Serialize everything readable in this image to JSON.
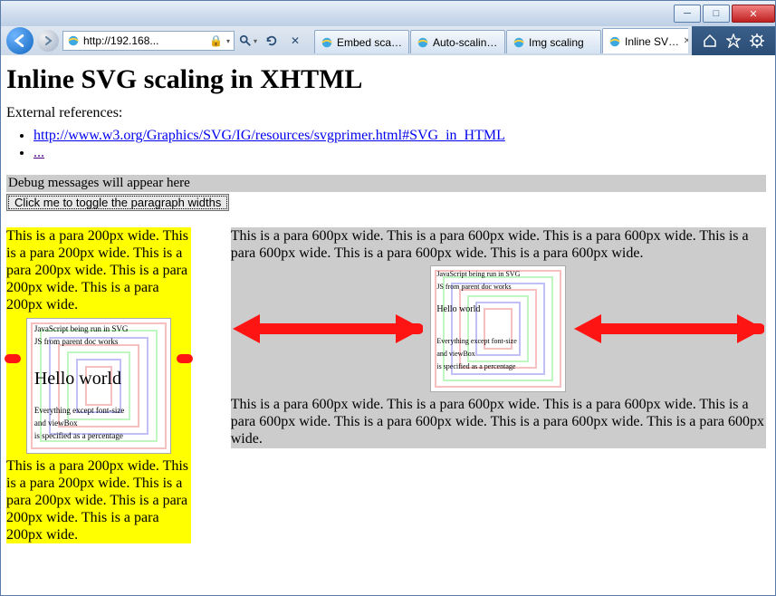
{
  "window": {
    "minimize": "▁",
    "maximize": "▢",
    "close": "✕"
  },
  "nav": {
    "url_text": "http://192.168...",
    "search_placeholder": "Search"
  },
  "tabs": {
    "t0": "Embed scaling",
    "t1": "Auto-scaling a...",
    "t2": "Img scaling",
    "t3": "Inline SVG s..."
  },
  "page": {
    "title": "Inline SVG scaling in XHTML",
    "refs_label": "External references:",
    "link1": "http://www.w3.org/Graphics/SVG/IG/resources/svgprimer.html#SVG_in_HTML",
    "link2": "...",
    "debug_msg": "Debug messages will appear here",
    "toggle_btn": "Click me to toggle the paragraph widths",
    "para200": "This is a para 200px wide. This is a para 200px wide. This is a para 200px wide. This is a para 200px wide. This is a para 200px wide.",
    "para600a": "This is a para 600px wide. This is a para 600px wide. This is a para 600px wide. This is a para 600px wide. This is a para 600px wide. This is a para 600px wide.",
    "para600b": "This is a para 600px wide. This is a para 600px wide. This is a para 600px wide. This is a para 600px wide. This is a para 600px wide. This is a para 600px wide. This is a para 600px wide."
  },
  "svg": {
    "js_run": "JavaScript being run in SVG",
    "js_parent": "JS from parent doc works",
    "hello": "Hello world",
    "everything": "Everything except font-size",
    "and_vb": "and viewBox",
    "specified": "is specified as a percentage",
    "nest_colors": [
      "#f7b7b7",
      "#b7f7b7",
      "#b7b7f7",
      "#f7b7b7",
      "#b7f7b7",
      "#b7b7f7",
      "#f7b7b7"
    ]
  }
}
